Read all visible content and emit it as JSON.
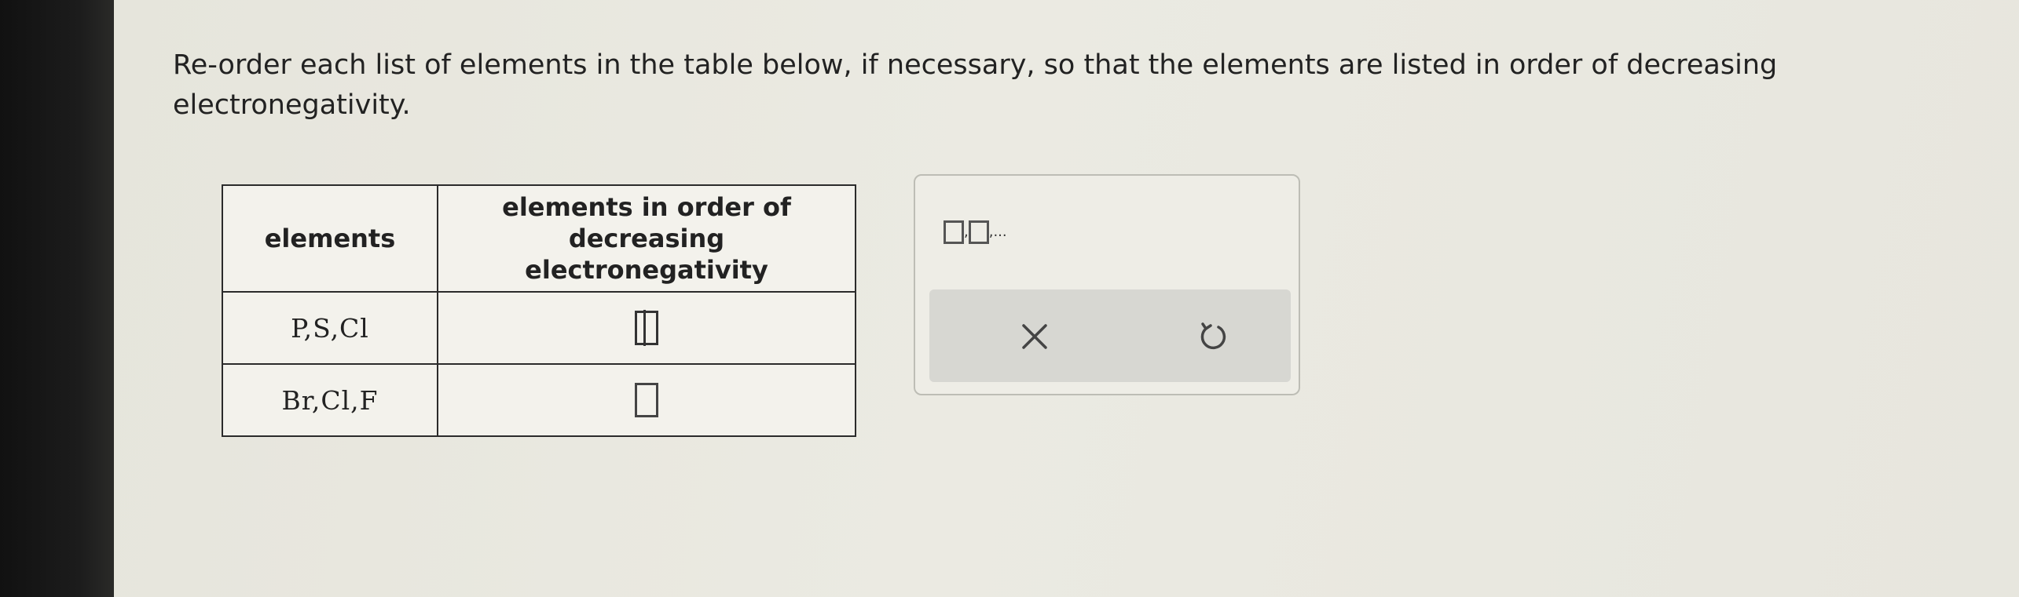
{
  "question": {
    "text": "Re-order each list of elements in the table below, if necessary, so that the elements are listed in order of decreasing electronegativity."
  },
  "table": {
    "headers": [
      "elements",
      "elements in order of decreasing electronegativity"
    ],
    "rows": [
      {
        "elements": "P,S,Cl",
        "answer": ""
      },
      {
        "elements": "Br,Cl,F",
        "answer": ""
      }
    ]
  },
  "palette": {
    "template_suffix": ",...",
    "clear_icon": "close-icon",
    "undo_icon": "undo-icon"
  }
}
